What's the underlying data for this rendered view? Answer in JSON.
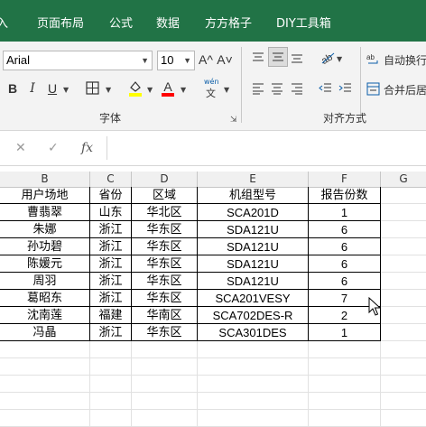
{
  "ribbon_tabs": [
    "入",
    "页面布局",
    "公式",
    "数据",
    "方方格子",
    "DIY工具箱"
  ],
  "font_group": {
    "font_name": "Arial",
    "font_size": "10",
    "grow_label": "A^",
    "shrink_label": "A˅",
    "bold": "B",
    "italic": "I",
    "underline": "U",
    "font_color_letter": "A",
    "pinyin_top": "wén",
    "pinyin_bottom": "文",
    "group_label": "字体",
    "fill_color": "#ffff00",
    "font_color": "#ff0000"
  },
  "alignment_group": {
    "wrap_text": "自动换行",
    "merge_center": "合并后居",
    "group_label": "对齐方式"
  },
  "formula_bar": {
    "cancel": "✕",
    "enter": "✓",
    "fx": "fx",
    "value": ""
  },
  "columns": [
    "B",
    "C",
    "D",
    "E",
    "F",
    "G"
  ],
  "table": {
    "header": [
      "用户场地",
      "省份",
      "区域",
      "机组型号",
      "报告份数"
    ],
    "rows": [
      [
        "曹翡翠",
        "山东",
        "华北区",
        "SCA201D",
        "1"
      ],
      [
        "朱娜",
        "浙江",
        "华东区",
        "SDA121U",
        "6"
      ],
      [
        "孙功碧",
        "浙江",
        "华东区",
        "SDA121U",
        "6"
      ],
      [
        "陈媛元",
        "浙江",
        "华东区",
        "SDA121U",
        "6"
      ],
      [
        "周羽",
        "浙江",
        "华东区",
        "SDA121U",
        "6"
      ],
      [
        "葛昭东",
        "浙江",
        "华东区",
        "SCA201VESY",
        "7"
      ],
      [
        "沈南莲",
        "福建",
        "华南区",
        "SCA702DES-R",
        "2"
      ],
      [
        "冯晶",
        "浙江",
        "华东区",
        "SCA301DES",
        "1"
      ]
    ]
  }
}
